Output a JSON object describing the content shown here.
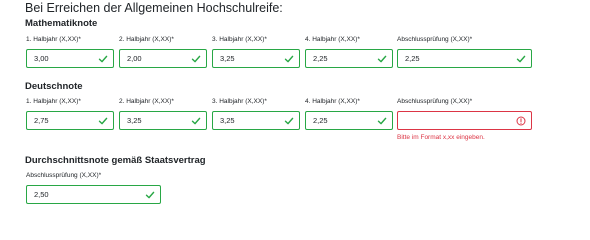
{
  "heading": "Bei Erreichen der Allgemeinen Hochschulreife:",
  "sections": [
    {
      "title": "Mathematiknote",
      "fields": [
        {
          "label": "1. Halbjahr (X,XX)*",
          "value": "3,00",
          "status": "valid",
          "icon": "check-icon"
        },
        {
          "label": "2. Halbjahr (X,XX)*",
          "value": "2,00",
          "status": "valid",
          "icon": "check-icon"
        },
        {
          "label": "3. Halbjahr (X,XX)*",
          "value": "3,25",
          "status": "valid",
          "icon": "check-icon"
        },
        {
          "label": "4. Halbjahr (X,XX)*",
          "value": "2,25",
          "status": "valid",
          "icon": "check-icon"
        },
        {
          "label": "Abschlussprüfung (X,XX)*",
          "value": "2,25",
          "status": "valid",
          "icon": "check-icon"
        }
      ]
    },
    {
      "title": "Deutschnote",
      "fields": [
        {
          "label": "1. Halbjahr (X,XX)*",
          "value": "2,75",
          "status": "valid",
          "icon": "check-icon"
        },
        {
          "label": "2. Halbjahr (X,XX)*",
          "value": "3,25",
          "status": "valid",
          "icon": "check-icon"
        },
        {
          "label": "3. Halbjahr (X,XX)*",
          "value": "3,25",
          "status": "valid",
          "icon": "check-icon"
        },
        {
          "label": "4. Halbjahr (X,XX)*",
          "value": "2,25",
          "status": "valid",
          "icon": "check-icon"
        },
        {
          "label": "Abschlussprüfung (X,XX)*",
          "value": "",
          "status": "invalid",
          "icon": "error-icon",
          "error": "Bitte im Format x,xx eingeben."
        }
      ]
    },
    {
      "title": "Durchschnittsnote gemäß Staatsvertrag",
      "fields": [
        {
          "label": "Abschlussprüfung (X,XX)*",
          "value": "2,50",
          "status": "valid",
          "icon": "check-icon"
        }
      ]
    }
  ],
  "colors": {
    "valid": "#28a745",
    "invalid": "#dc3545"
  }
}
